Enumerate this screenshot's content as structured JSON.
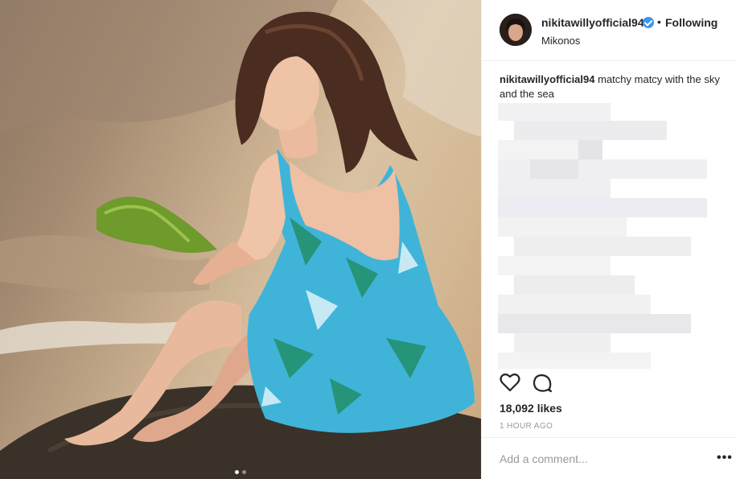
{
  "post": {
    "username": "nikitawillyofficial94",
    "follow_status": "Following",
    "separator": "•",
    "location": "Mikonos",
    "caption_user": "nikitawillyofficial94",
    "caption_text": "matchy matcy with the sky and the sea",
    "likes": "18,092 likes",
    "time": "1 HOUR AGO",
    "comment_placeholder": "Add a comment...",
    "more_label": "•••",
    "carousel": {
      "count": 2,
      "active": 1
    }
  },
  "icons": {
    "verified": "verified-badge-icon",
    "like": "heart-icon",
    "comment": "comment-bubble-icon",
    "more": "more-options-icon"
  },
  "colors": {
    "verified_blue": "#3897f0",
    "text": "#262626",
    "muted": "#999999",
    "border": "#efefef"
  }
}
